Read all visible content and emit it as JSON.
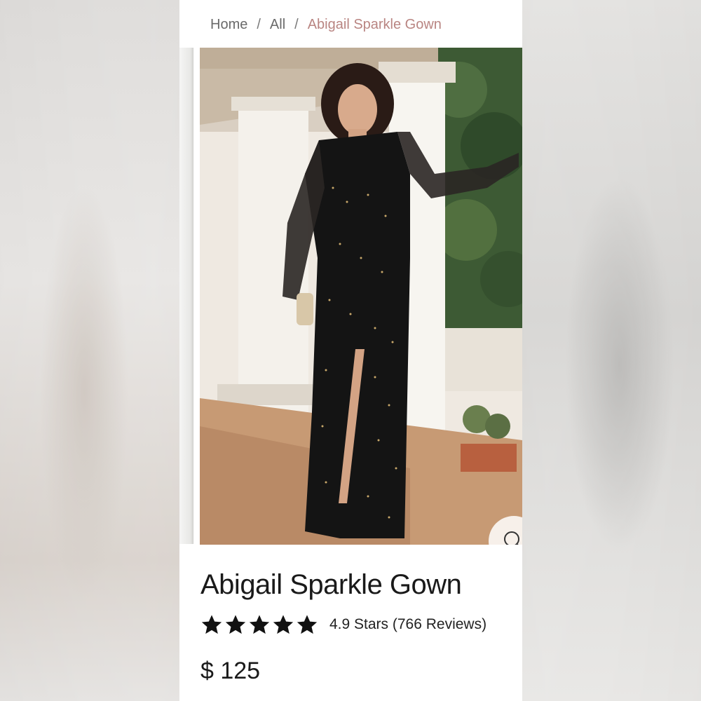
{
  "breadcrumb": {
    "home": "Home",
    "separator": "/",
    "all": "All",
    "current": "Abigail Sparkle Gown"
  },
  "product": {
    "title": "Abigail Sparkle Gown",
    "rating_stars": 5,
    "rating_text": "4.9 Stars (766 Reviews)",
    "price": "$ 125",
    "image_alt": "woman-wearing-black-sparkle-gown"
  },
  "icons": {
    "zoom": "magnifier-icon",
    "star": "star-icon"
  },
  "colors": {
    "breadcrumb_current": "#b98582",
    "text": "#1a1a1a",
    "star": "#111111"
  }
}
